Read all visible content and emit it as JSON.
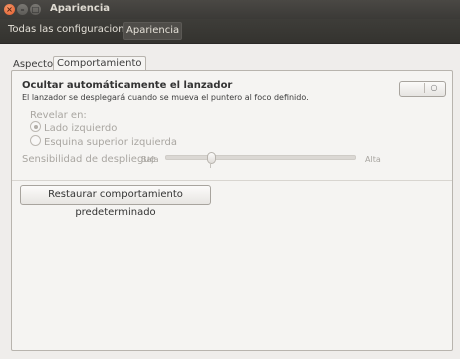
{
  "window": {
    "title": "Apariencia",
    "close_glyph": "×",
    "min_glyph": "–",
    "max_glyph": "□"
  },
  "toolbar": {
    "all_settings": "Todas las configuraciones",
    "current": "Apariencia"
  },
  "tabs": [
    {
      "label": "Aspecto",
      "active": false
    },
    {
      "label": "Comportamiento",
      "active": true
    }
  ],
  "launcher": {
    "heading": "Ocultar automáticamente el lanzador",
    "description": "El lanzador se desplegará cuando se mueva el puntero al foco definido.",
    "toggle_on": false,
    "toggle_glyph": "○"
  },
  "reveal": {
    "label": "Revelar en:",
    "options": [
      {
        "label": "Lado izquierdo",
        "selected": true
      },
      {
        "label": "Esquina superior izquierda",
        "selected": false
      }
    ]
  },
  "sensitivity": {
    "label": "Sensibilidad de despliegue",
    "low_label": "Baja",
    "high_label": "Alta",
    "value_fraction": 0.24
  },
  "restore_button": "Restaurar comportamiento predeterminado",
  "icons": {
    "close": "close-icon",
    "minimize": "minimize-icon",
    "maximize": "maximize-icon"
  }
}
